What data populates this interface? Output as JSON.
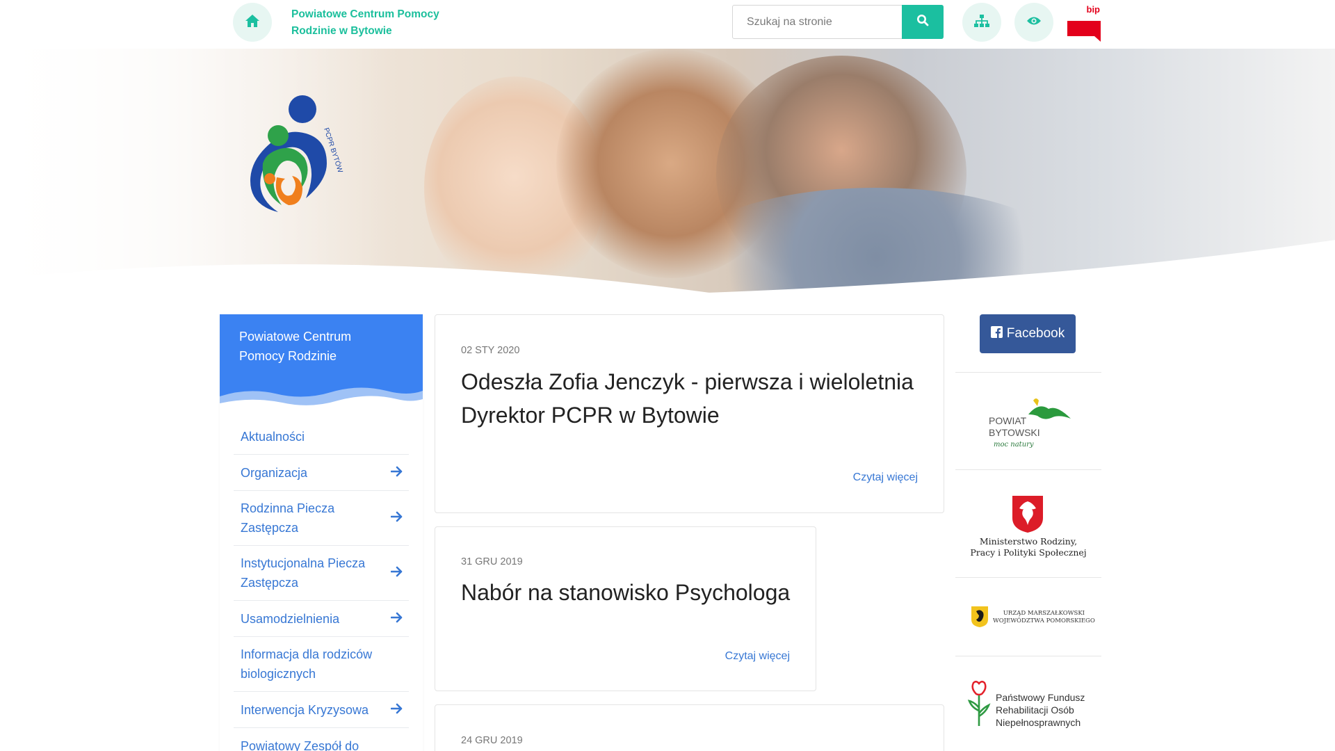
{
  "header": {
    "brand_name": "Powiatowe Centrum Pomocy Rodzinie w Bytowie",
    "search": {
      "placeholder": "Szukaj na stronie"
    },
    "bip_label": "bip"
  },
  "hero": {
    "logo_text": "PCPR BYTÓW"
  },
  "sidebar": {
    "title": "Powiatowe Centrum Pomocy Rodzinie",
    "items": [
      {
        "label": "Aktualności",
        "has_arrow": false
      },
      {
        "label": "Organizacja",
        "has_arrow": true
      },
      {
        "label": "Rodzinna Piecza Zastępcza",
        "has_arrow": true
      },
      {
        "label": "Instytucjonalna Piecza Zastępcza",
        "has_arrow": true
      },
      {
        "label": "Usamodzielnienia",
        "has_arrow": true
      },
      {
        "label": "Informacja dla rodziców biologicznych",
        "has_arrow": false
      },
      {
        "label": "Interwencja Kryzysowa",
        "has_arrow": true
      },
      {
        "label": "Powiatowy Zespół do",
        "has_arrow": false
      }
    ]
  },
  "news": [
    {
      "date": "02 STY 2020",
      "title": "Odeszła Zofia Jenczyk - pierwsza i wieloletnia Dyrektor PCPR w Bytowie",
      "more": "Czytaj więcej"
    },
    {
      "date": "31 GRU 2019",
      "title": "Nabór na stanowisko Psychologa",
      "more": "Czytaj więcej"
    },
    {
      "date": "24 GRU 2019",
      "title": "",
      "more": ""
    }
  ],
  "aside": {
    "facebook_label": "Facebook",
    "partners": [
      {
        "line1": "POWIAT",
        "line2": "BYTOWSKI",
        "line3": "moc natury"
      },
      {
        "line1": "Ministerstwo Rodziny,",
        "line2": "Pracy i Polityki Społecznej"
      },
      {
        "line1": "URZĄD MARSZAŁKOWSKI",
        "line2": "WOJEWÓDZTWA POMORSKIEGO"
      },
      {
        "line1": "Państwowy Fundusz",
        "line2": "Rehabilitacji Osób",
        "line3": "Niepełnosprawnych"
      }
    ]
  },
  "colors": {
    "accent": "#1bbfa0",
    "brand_text": "#1bbf9c",
    "sidebar_head": "#3b82f2",
    "link": "#3777d4",
    "facebook": "#355899",
    "bip_red": "#e3001b"
  },
  "icons": [
    "home-icon",
    "search-icon",
    "sitemap-icon",
    "eye-icon",
    "bip-flag-icon",
    "arrow-right-icon",
    "facebook-icon"
  ]
}
